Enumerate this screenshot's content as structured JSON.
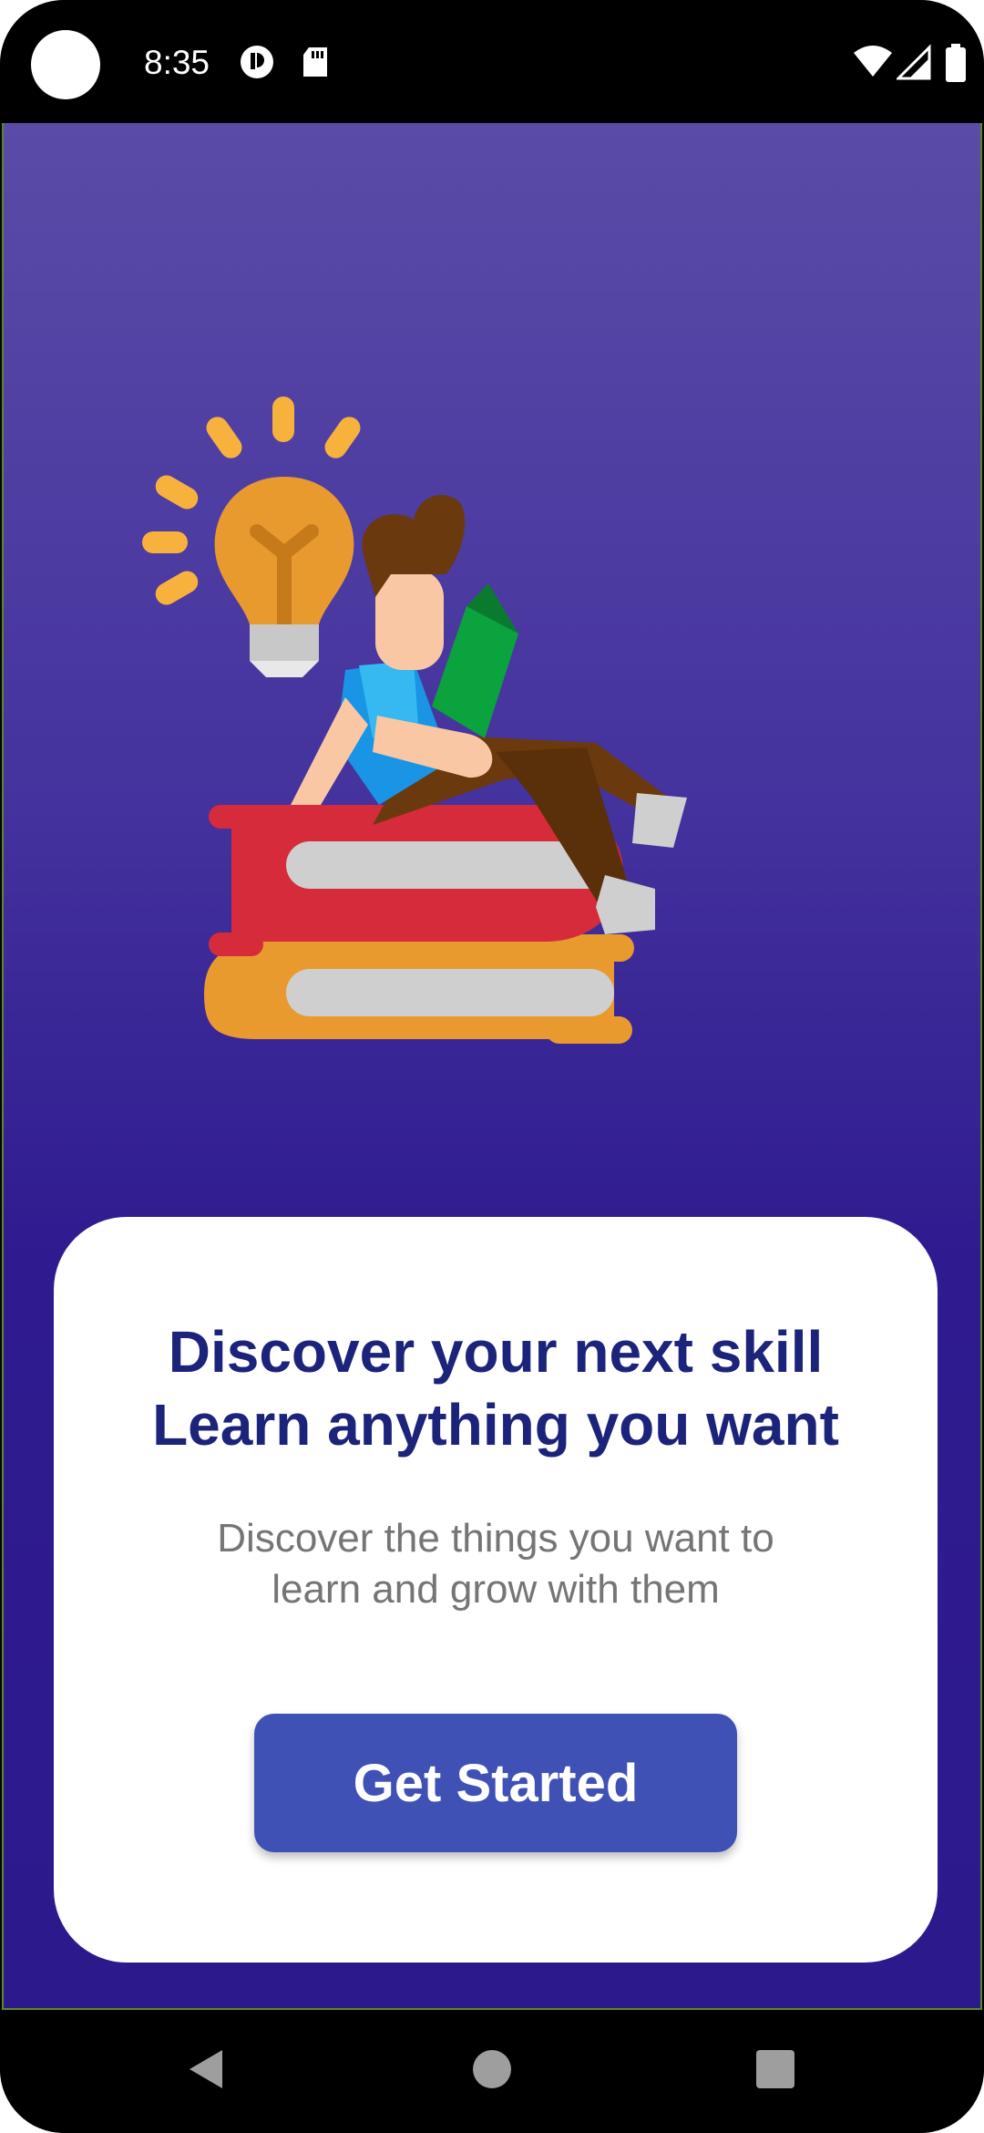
{
  "status_bar": {
    "time": "8:35",
    "left_icons": [
      "sync-icon",
      "sd-card-icon"
    ],
    "right_icons": [
      "wifi-icon",
      "signal-icon",
      "battery-icon"
    ]
  },
  "onboarding": {
    "illustration": "reading-person-on-books-illustration",
    "headline_line1": "Discover your next skill",
    "headline_line2": "Learn anything you want",
    "subtext_line1": "Discover the things you want to",
    "subtext_line2": "learn and grow with them",
    "cta_label": "Get Started"
  },
  "nav_bar": {
    "buttons": [
      "back-icon",
      "home-icon",
      "recents-icon"
    ]
  },
  "colors": {
    "background_top": "#5a4ba7",
    "background_bottom": "#2c1a8d",
    "headline": "#1b237a",
    "subtext": "#757575",
    "cta": "#3f51b5"
  }
}
